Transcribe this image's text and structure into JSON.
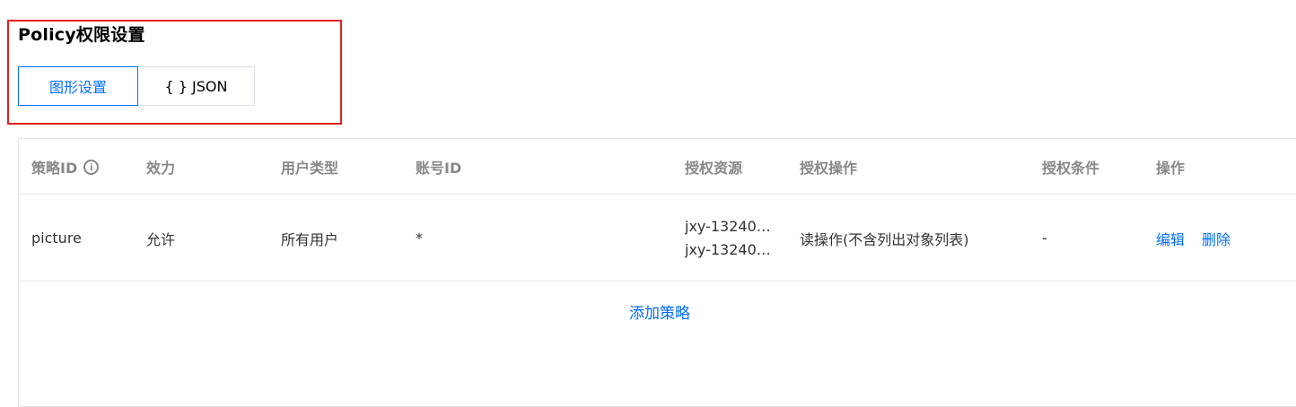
{
  "section": {
    "title": "Policy权限设置",
    "tabs": [
      "图形设置",
      "{ } JSON"
    ],
    "active_tab": "图形设置"
  },
  "table": {
    "columns": [
      "策略ID",
      "效力",
      "用户类型",
      "账号ID",
      "授权资源",
      "授权操作",
      "授权条件",
      "操作"
    ],
    "rows": [
      {
        "policy_id": "picture",
        "effect": "允许",
        "user_type": "所有用户",
        "account_id": "*",
        "resources": [
          "jxy-13240…",
          "jxy-13240…"
        ],
        "actions": "读操作(不含列出对象列表)",
        "condition": "-",
        "ops": [
          "编辑",
          "删除"
        ]
      }
    ]
  },
  "add_policy_label": "添加策略",
  "colors": {
    "accent": "#006eff",
    "highlight_border": "#e02020",
    "header_text": "#888888"
  }
}
